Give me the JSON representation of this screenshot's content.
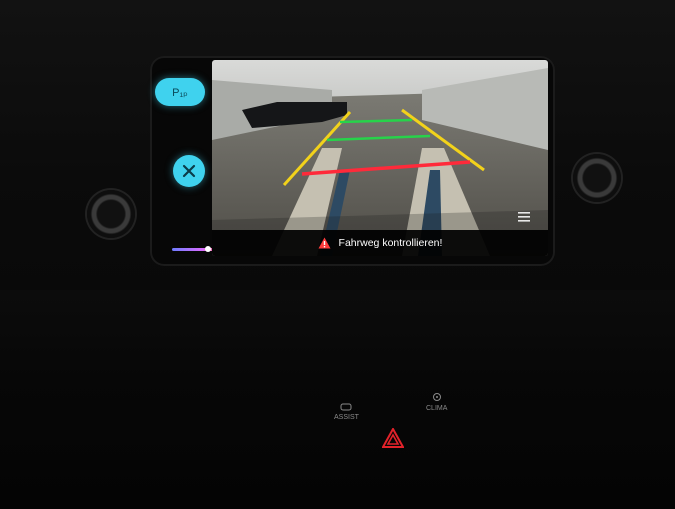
{
  "screen": {
    "warning_text": "Fahrweg kontrollieren!"
  },
  "buttons": {
    "park_assist_label": "P₁ₚ",
    "close_icon": "close-icon"
  },
  "console": {
    "assist_label": "ASSIST",
    "clima_label": "CLIMA"
  },
  "colors": {
    "accent_cyan": "#3fd2ee",
    "guide_yellow": "#f2d21b",
    "guide_green": "#27d34a",
    "guide_red": "#ff2a3a",
    "hazard_red": "#e2222a"
  },
  "icons": {
    "warning": "warning-triangle-icon",
    "menu": "menu-icon",
    "hazard": "hazard-light-icon"
  }
}
